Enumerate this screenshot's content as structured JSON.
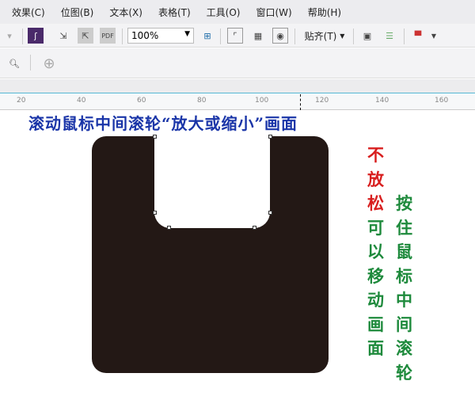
{
  "menu": [
    "效果(C)",
    "位图(B)",
    "文本(X)",
    "表格(T)",
    "工具(O)",
    "窗口(W)",
    "帮助(H)"
  ],
  "toolbar": {
    "zoom_value": "100%",
    "snap_label": "贴齐(T)"
  },
  "ruler": [
    "20",
    "40",
    "60",
    "80",
    "100",
    "120",
    "140",
    "160"
  ],
  "canvas": {
    "title": "滚动鼠标中间滚轮“放大或缩小”画面",
    "left_column_red": [
      "不",
      "放",
      "松"
    ],
    "left_column_green": [
      "可",
      "以",
      "移",
      "动",
      "画",
      "面"
    ],
    "right_column": [
      "按",
      "住",
      "鼠",
      "标",
      "中",
      "间",
      "滚",
      "轮"
    ],
    "colors": {
      "shape": "#231815",
      "title": "#1a35a8",
      "red": "#d81e1e",
      "green": "#1e8a3c"
    }
  }
}
